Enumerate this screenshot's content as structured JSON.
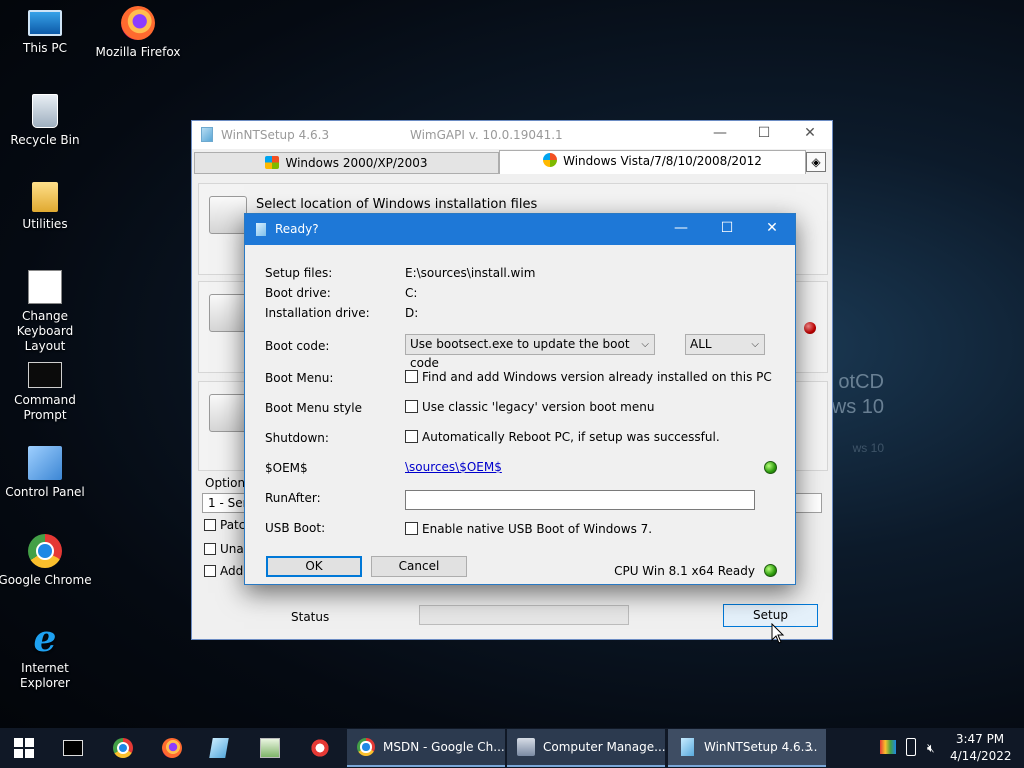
{
  "desktop": {
    "icons": [
      {
        "label": "This PC",
        "icon": "this-pc-icon"
      },
      {
        "label": "Mozilla Firefox",
        "icon": "firefox-icon"
      },
      {
        "label": "Recycle Bin",
        "icon": "recycle-bin-icon"
      },
      {
        "label": "Utilities",
        "icon": "folder-icon"
      },
      {
        "label": "Change Keyboard Layout",
        "icon": "keyboard-layout-icon"
      },
      {
        "label": "Command Prompt",
        "icon": "command-prompt-icon"
      },
      {
        "label": "Control Panel",
        "icon": "control-panel-icon"
      },
      {
        "label": "Google Chrome",
        "icon": "chrome-icon"
      },
      {
        "label": "Internet Explorer",
        "icon": "internet-explorer-icon"
      }
    ],
    "wallpaper_text": [
      "otCD",
      "ws 10",
      "ws 10"
    ]
  },
  "main_window": {
    "title": "WinNTSetup 4.6.3",
    "version": "WimGAPI v. 10.0.19041.1",
    "controls": {
      "minimize": "—",
      "maximize": "☐",
      "close": "✕"
    },
    "tabs": [
      {
        "label": "Windows 2000/XP/2003"
      },
      {
        "label": "Windows Vista/7/8/10/2008/2012"
      }
    ],
    "section1_title": "Select location of Windows installation files",
    "options_label": "Options",
    "options_combo_value": "1 - Serv",
    "option_checks": [
      "Patch",
      "Unat",
      "Add"
    ],
    "status_label": "Status",
    "progress_percent": 0,
    "setup_button": "Setup"
  },
  "dialog": {
    "title": "Ready?",
    "controls": {
      "minimize": "—",
      "maximize": "☐",
      "close": "✕"
    },
    "setup_files_label": "Setup files:",
    "setup_files_value": "E:\\sources\\install.wim",
    "boot_drive_label": "Boot drive:",
    "boot_drive_value": "C:",
    "install_drive_label": "Installation drive:",
    "install_drive_value": "D:",
    "boot_code_label": "Boot code:",
    "boot_code_value": "Use bootsect.exe to update the boot code",
    "boot_code_target": "ALL",
    "boot_menu_label": "Boot Menu:",
    "boot_menu_check": "Find and add Windows version already installed on this PC",
    "boot_menu_style_label": "Boot Menu style",
    "boot_menu_style_check": "Use classic 'legacy' version boot menu",
    "shutdown_label": "Shutdown:",
    "shutdown_check": "Automatically Reboot PC, if setup was successful.",
    "oem_label": "$OEM$",
    "oem_link": "\\sources\\$OEM$",
    "runafter_label": "RunAfter:",
    "runafter_value": "",
    "usb_boot_label": "USB Boot:",
    "usb_boot_check": "Enable native USB Boot of Windows 7.",
    "ok_button": "OK",
    "cancel_button": "Cancel",
    "cpu_status": "CPU Win 8.1 x64 Ready"
  },
  "taskbar": {
    "pinned": [
      "start-icon",
      "command-prompt-icon",
      "chrome-icon",
      "firefox-icon",
      "winntsetup-icon",
      "notepad-icon",
      "snipping-tool-icon"
    ],
    "tasks": [
      {
        "label": "MSDN - Google Ch...",
        "icon": "chrome-icon"
      },
      {
        "label": "Computer Manage...",
        "icon": "computer-management-icon"
      },
      {
        "label": "WinNTSetup 4.6.3",
        "icon": "winntsetup-icon"
      }
    ],
    "task_overflow": "...",
    "tray_icons": [
      "color-icon",
      "usb-icon",
      "volume-muted-icon"
    ],
    "time": "3:47 PM",
    "date": "4/14/2022"
  }
}
